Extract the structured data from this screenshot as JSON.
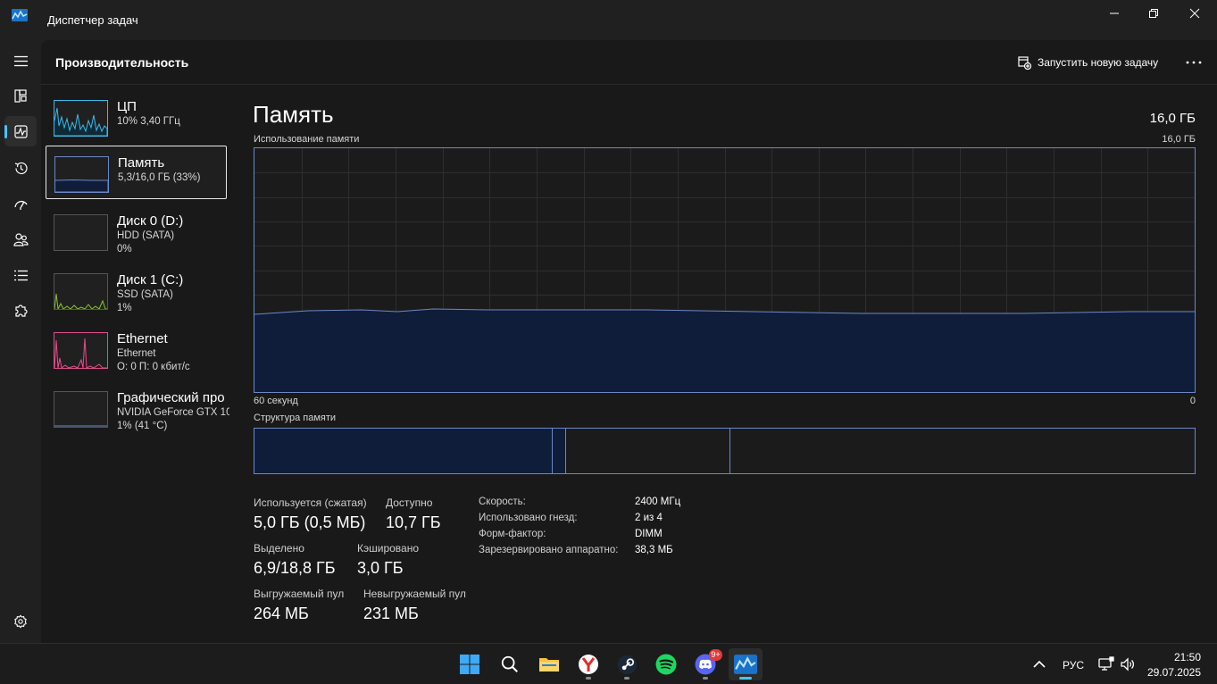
{
  "window": {
    "title": "Диспетчер задач"
  },
  "header": {
    "title": "Производительность",
    "run_task_label": "Запустить новую задачу"
  },
  "perf_list": [
    {
      "name": "ЦП",
      "line1": "10% 3,40 ГГц",
      "line2": ""
    },
    {
      "name": "Память",
      "line1": "5,3/16,0 ГБ (33%)",
      "line2": ""
    },
    {
      "name": "Диск 0 (D:)",
      "line1": "HDD (SATA)",
      "line2": "0%"
    },
    {
      "name": "Диск 1 (C:)",
      "line1": "SSD (SATA)",
      "line2": "1%"
    },
    {
      "name": "Ethernet",
      "line1": "Ethernet",
      "line2": "О: 0 П: 0 кбит/с"
    },
    {
      "name": "Графический про",
      "line1": "NVIDIA GeForce GTX 10",
      "line2": "1% (41 °C)"
    }
  ],
  "detail": {
    "title": "Память",
    "total": "16,0 ГБ",
    "usage_label": "Использование памяти",
    "usage_max": "16,0 ГБ",
    "x_left": "60 секунд",
    "x_right": "0",
    "structure_label": "Структура памяти",
    "usage_percent": 33
  },
  "stats": {
    "in_use_label": "Используется (сжатая)",
    "in_use_value": "5,0 ГБ (0,5 МБ)",
    "available_label": "Доступно",
    "available_value": "10,7 ГБ",
    "committed_label": "Выделено",
    "committed_value": "6,9/18,8 ГБ",
    "cached_label": "Кэшировано",
    "cached_value": "3,0 ГБ",
    "paged_label": "Выгружаемый пул",
    "paged_value": "264 МБ",
    "nonpaged_label": "Невыгружаемый пул",
    "nonpaged_value": "231 МБ"
  },
  "specs": [
    {
      "label": "Скорость:",
      "value": "2400 МГц"
    },
    {
      "label": "Использовано гнезд:",
      "value": "2 из 4"
    },
    {
      "label": "Форм-фактор:",
      "value": "DIMM"
    },
    {
      "label": "Зарезервировано аппаратно:",
      "value": "38,3 МБ"
    }
  ],
  "taskbar": {
    "lang": "РУС",
    "time": "21:50",
    "date": "29.07.2025",
    "discord_badge": "9+"
  },
  "colors": {
    "accent": "#4cc2ff",
    "memory_line": "#6b88c6",
    "memory_fill": "#0f1d3a",
    "cpu_line": "#3fb8e6",
    "disk_line": "#8cbf3f",
    "net_line": "#e0508a"
  }
}
